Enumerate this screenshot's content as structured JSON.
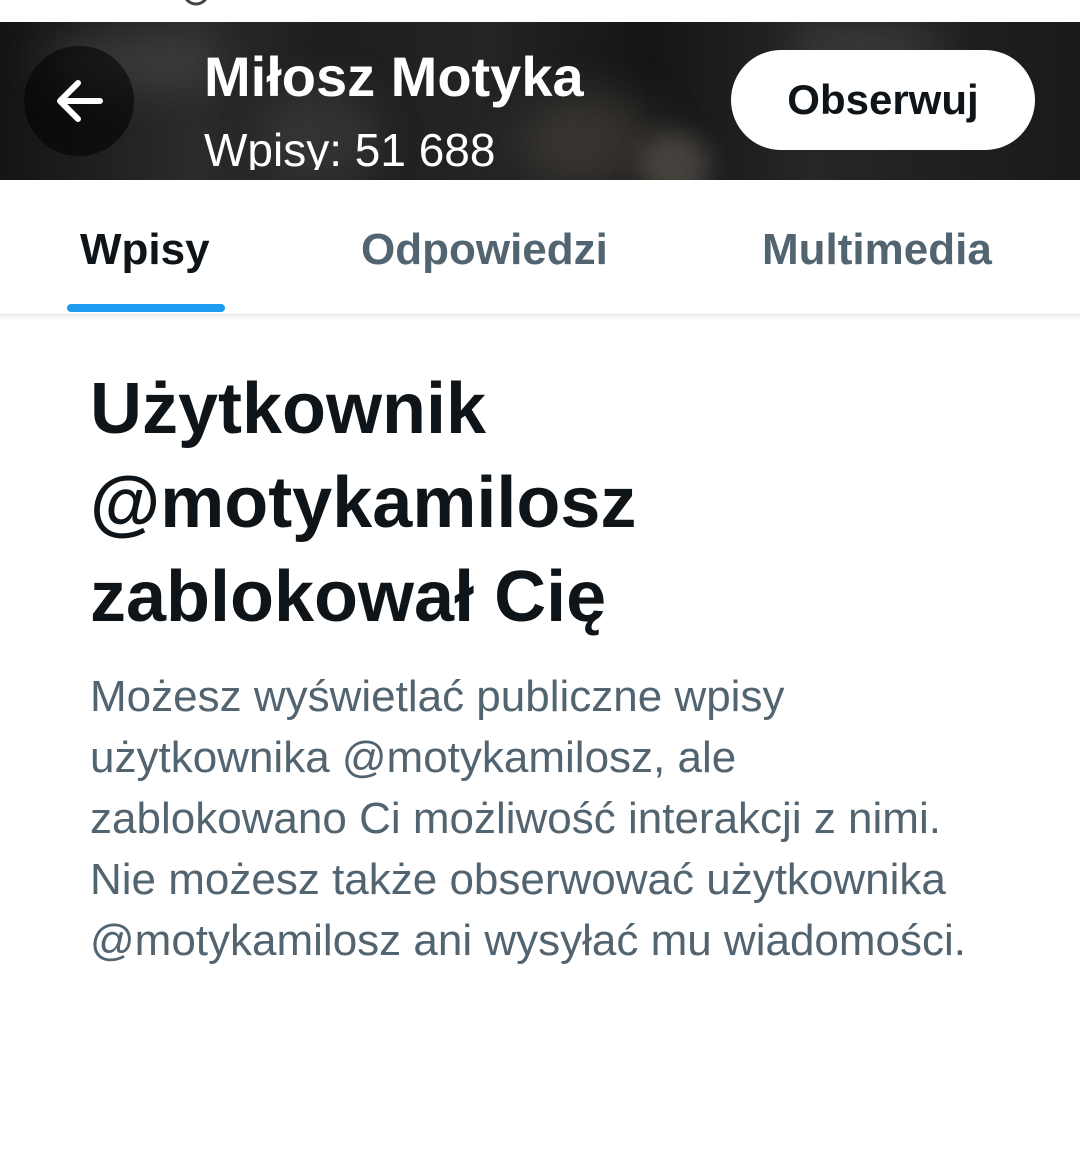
{
  "header": {
    "back_icon": "arrow-left-icon",
    "name": "Miłosz Motyka",
    "posts_count": "Wpisy: 51 688",
    "follow_label": "Obserwuj"
  },
  "tabs": [
    {
      "label": "Wpisy",
      "active": true
    },
    {
      "label": "Odpowiedzi",
      "active": false
    },
    {
      "label": "Multimedia",
      "active": false
    }
  ],
  "blocked": {
    "title": "Użytkownik @motykamilosz zablokował Cię",
    "message": "Możesz wyświetlać publiczne wpisy użytkownika @motykamilosz, ale zablokowano Ci możliwość interakcji z nimi. Nie możesz także obserwować użytkownika @motykamilosz ani wysyłać mu wiadomości."
  },
  "colors": {
    "accent": "#1d9bf0",
    "text_primary": "#0f1419",
    "text_secondary": "#536471"
  }
}
